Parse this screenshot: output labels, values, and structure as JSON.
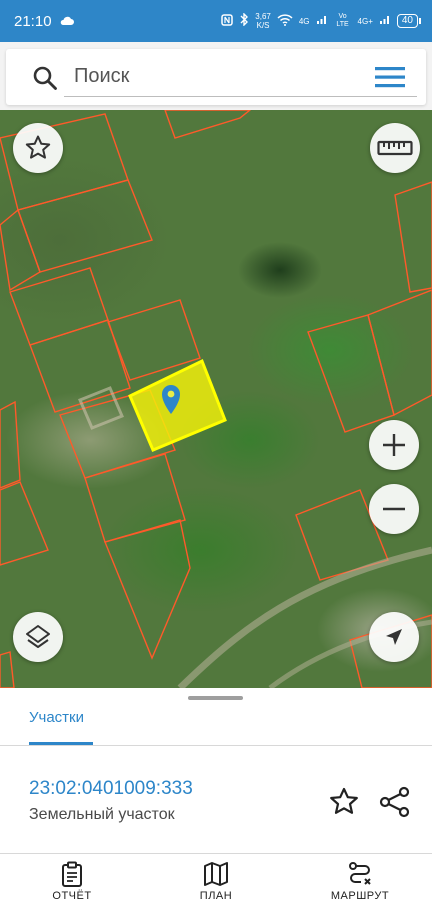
{
  "status_bar": {
    "time": "21:10",
    "net_speed": "3,67",
    "net_unit": "K/S",
    "signal1": "4G",
    "volte": "Vo LTE",
    "signal2": "4G+",
    "battery": "40"
  },
  "search": {
    "placeholder": "Поиск"
  },
  "map": {
    "selected_parcel_color": "#ffff00",
    "boundary_color": "#ff5a2a",
    "marker_color": "#2d86c9"
  },
  "sheet": {
    "tab_label": "Участки",
    "parcel_number": "23:02:0401009:333",
    "parcel_type": "Земельный участок"
  },
  "nav": {
    "report": "ОТЧЁТ",
    "plan": "ПЛАН",
    "route": "МАРШРУТ"
  },
  "colors": {
    "accent": "#2d86c9",
    "status_bar": "#2e86c8"
  }
}
